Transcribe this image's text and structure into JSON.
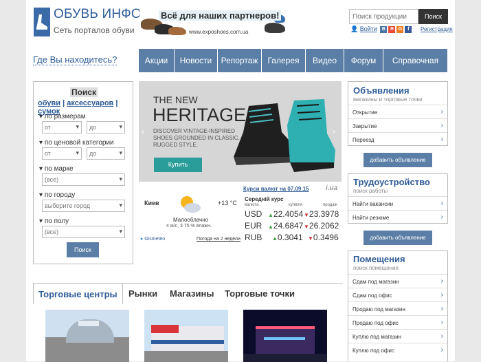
{
  "header": {
    "logo_title": "ОБУВЬ ИНФО",
    "logo_subtitle": "Сеть порталов обуви",
    "banner_text": "Всё для наших партнеров!",
    "banner_url": "www.exposhoes.com.ua",
    "search_placeholder": "Поиск продукции",
    "search_button": "Поиск",
    "login": "Войти",
    "register": "Регистрация",
    "social": [
      "В",
      "Я",
      "G",
      "f"
    ]
  },
  "where": "Где Вы находитесь?",
  "nav": [
    "Акции",
    "Новости",
    "Репортаж",
    "Галерея",
    "Видео",
    "Форум",
    "Справочная"
  ],
  "search_panel": {
    "title": "Поиск",
    "tab_shoes": "обуви",
    "tab_acc": "аксессуаров",
    "tab_bags": "сумок",
    "size_label": "по размерам",
    "from": "от",
    "to": "до",
    "price_label": "по ценовой категории",
    "brand_label": "по марке",
    "all": "(все)",
    "city_label": "по городу",
    "city_placeholder": "выберите город",
    "sex_label": "по полу",
    "button": "Поиск"
  },
  "slider": {
    "line1": "THE NEW",
    "line2": "HERITAGE",
    "desc": "DISCOVER VINTAGE-INSPIRED SHOES GROUNDED IN CLASSIC, RUGGED STYLE.",
    "button": "Купить"
  },
  "weather": {
    "city": "Киев",
    "temp": "+13 °C",
    "condition": "Малооблачно",
    "details": "4 м/с, 3   75 % влажн.",
    "provider": "Gismeteo",
    "forecast_link": "Погода на 2 недели"
  },
  "currency": {
    "title": "Курси валют на 07.09.15",
    "brand": "i.ua",
    "avg_label": "Середній курс",
    "col_currency": "валюта",
    "col_buy": "купівля",
    "col_sell": "продаж",
    "rows": [
      {
        "code": "USD",
        "buy": "22.4054",
        "sell": "23.3978"
      },
      {
        "code": "EUR",
        "buy": "24.6847",
        "sell": "26.2062"
      },
      {
        "code": "RUB",
        "buy": "0.3041",
        "sell": "0.3496"
      }
    ]
  },
  "ads": {
    "title": "Объявления",
    "sub": "магазины и торговые точки",
    "items": [
      "Открытие",
      "Закрытие",
      "Переезд"
    ],
    "button": "добавить объявление"
  },
  "jobs": {
    "title": "Трудоустройство",
    "sub": "поиск работы",
    "items": [
      "Найти вакансии",
      "Найти резюме"
    ],
    "button": "добавить объявление"
  },
  "rooms": {
    "title": "Помещения",
    "sub": "поиск помещения",
    "items": [
      "Сдам под магазин",
      "Сдам под офис",
      "Продаю под магазин",
      "Продаю под офис",
      "Куплю под магазин",
      "Куплю под офис"
    ]
  },
  "tabs": [
    "Торговые центры",
    "Рынки",
    "Магазины",
    "Торговые точки"
  ],
  "colors": {
    "accent": "#2e5b97",
    "nav": "#5a7ea5",
    "teal": "#2a9d9b"
  }
}
